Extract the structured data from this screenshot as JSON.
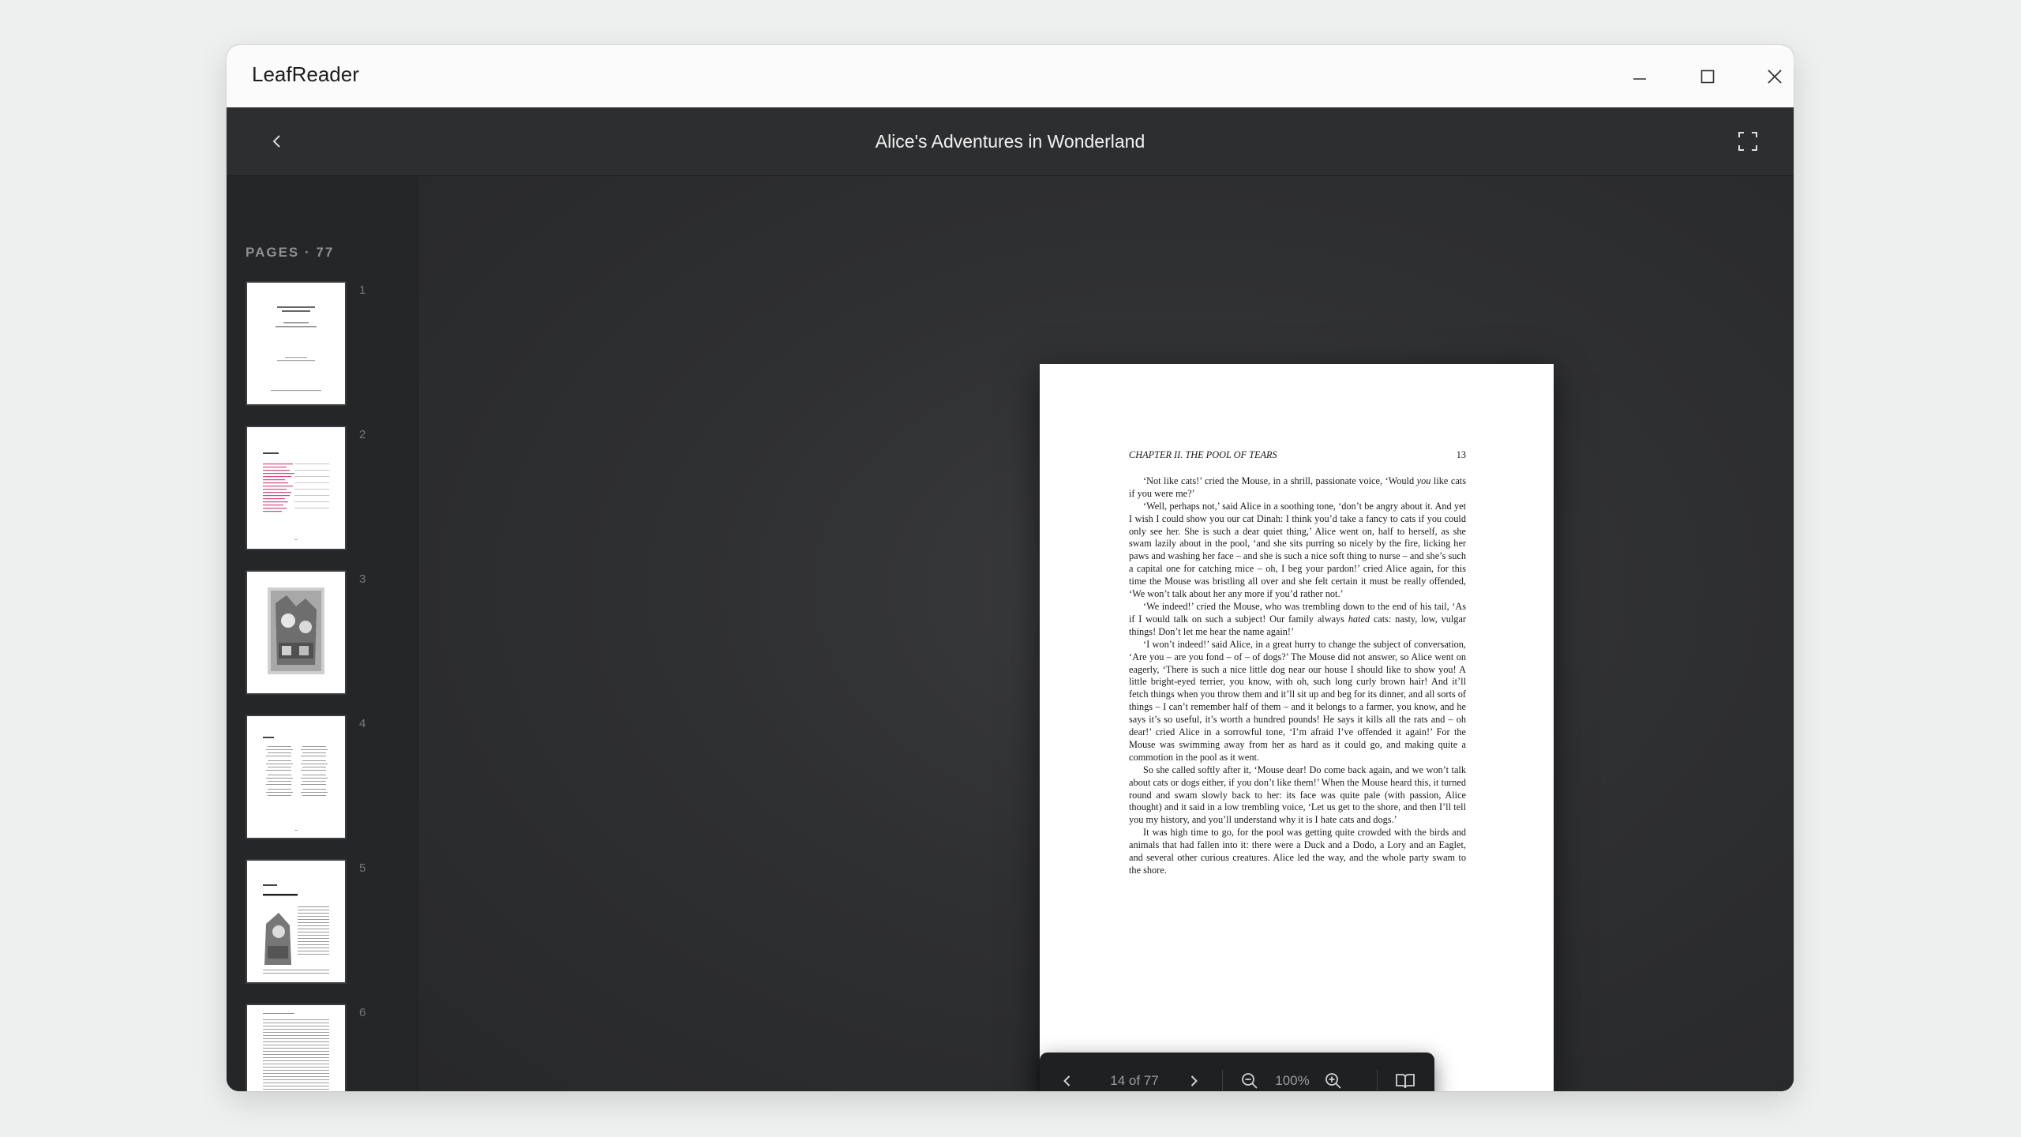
{
  "window": {
    "app_title": "LeafReader"
  },
  "header": {
    "document_title": "Alice's Adventures in Wonderland"
  },
  "sidebar": {
    "pages_label": "PAGES · 77",
    "thumbnails": [
      {
        "number": "1"
      },
      {
        "number": "2"
      },
      {
        "number": "3"
      },
      {
        "number": "4"
      },
      {
        "number": "5"
      },
      {
        "number": "6"
      }
    ]
  },
  "page": {
    "running_head": "CHAPTER II.  THE POOL OF TEARS",
    "page_number": "13",
    "paragraphs": [
      {
        "before": "‘Not like cats!’ cried the Mouse, in a shrill, passionate voice, ‘Would ",
        "em": "you",
        "after": " like cats if you were me?’"
      },
      {
        "before": "‘Well, perhaps not,’ said Alice in a soothing tone, ‘don’t be angry about it. And yet I wish I could show you our cat Dinah: I think you’d take a fancy to cats if you could only see her.  She is such a dear quiet thing,’ Alice went on, half to herself, as she swam lazily about in the pool, ‘and she sits purring so nicely by the fire, licking her paws and washing her face – and she is such a nice soft thing to nurse – and she’s such a capital one for catching mice – oh, I beg your pardon!’ cried Alice again, for this time the Mouse was bristling all over and she felt certain it must be really offended, ‘We won’t talk about her any more if you’d rather not.’",
        "em": "",
        "after": ""
      },
      {
        "before": "‘We indeed!’ cried the Mouse, who was trembling down to the end of his tail, ‘As if I would talk on such a subject!  Our family always ",
        "em": "hated",
        "after": " cats:  nasty, low, vulgar things!  Don’t let me hear the name again!’"
      },
      {
        "before": "‘I won’t indeed!’  said Alice, in a great hurry to change the subject of conversation, ‘Are you – are you fond – of – of dogs?’  The Mouse did not answer, so Alice went on eagerly, ‘There is such a nice little dog near our house I should like to show you!  A little bright-eyed terrier, you know, with oh, such long curly brown hair!  And it’ll fetch things when you throw them and it’ll sit up and beg for its dinner, and all sorts of things – I can’t remember half of them – and it belongs to a farmer, you know, and he says it’s so useful, it’s worth a hundred pounds!  He says it kills all the rats and – oh dear!’ cried Alice in a sorrowful tone, ‘I’m afraid I’ve offended it again!’  For the Mouse was swimming away from her as hard as it could go, and making quite a commotion in the pool as it went.",
        "em": "",
        "after": ""
      },
      {
        "before": "So she called softly after it, ‘Mouse dear!  Do come back again, and we won’t talk about cats or dogs either, if you don’t like them!’  When the Mouse heard this, it turned round and swam slowly back to her: its face was quite pale (with passion, Alice thought) and it said in a low trembling voice, ‘Let us get to the shore, and then I’ll tell you my history, and you’ll understand why it is I hate cats and dogs.’",
        "em": "",
        "after": ""
      },
      {
        "before": "It was high time to go, for the pool was getting quite crowded with the birds and animals that had fallen into it:  there were a Duck and a Dodo, a Lory and an Eaglet, and several other curious creatures.  Alice led the way, and the whole party swam to the shore.",
        "em": "",
        "after": ""
      }
    ]
  },
  "toolbar": {
    "page_indicator": "14 of 77",
    "zoom_level": "100%"
  },
  "colors": {
    "app_background": "#2b2c2e",
    "sidebar": "#252628",
    "toolbar": "#1f2022",
    "titlebar": "#fbfbfb",
    "toc_accent": "#d94a7f"
  }
}
